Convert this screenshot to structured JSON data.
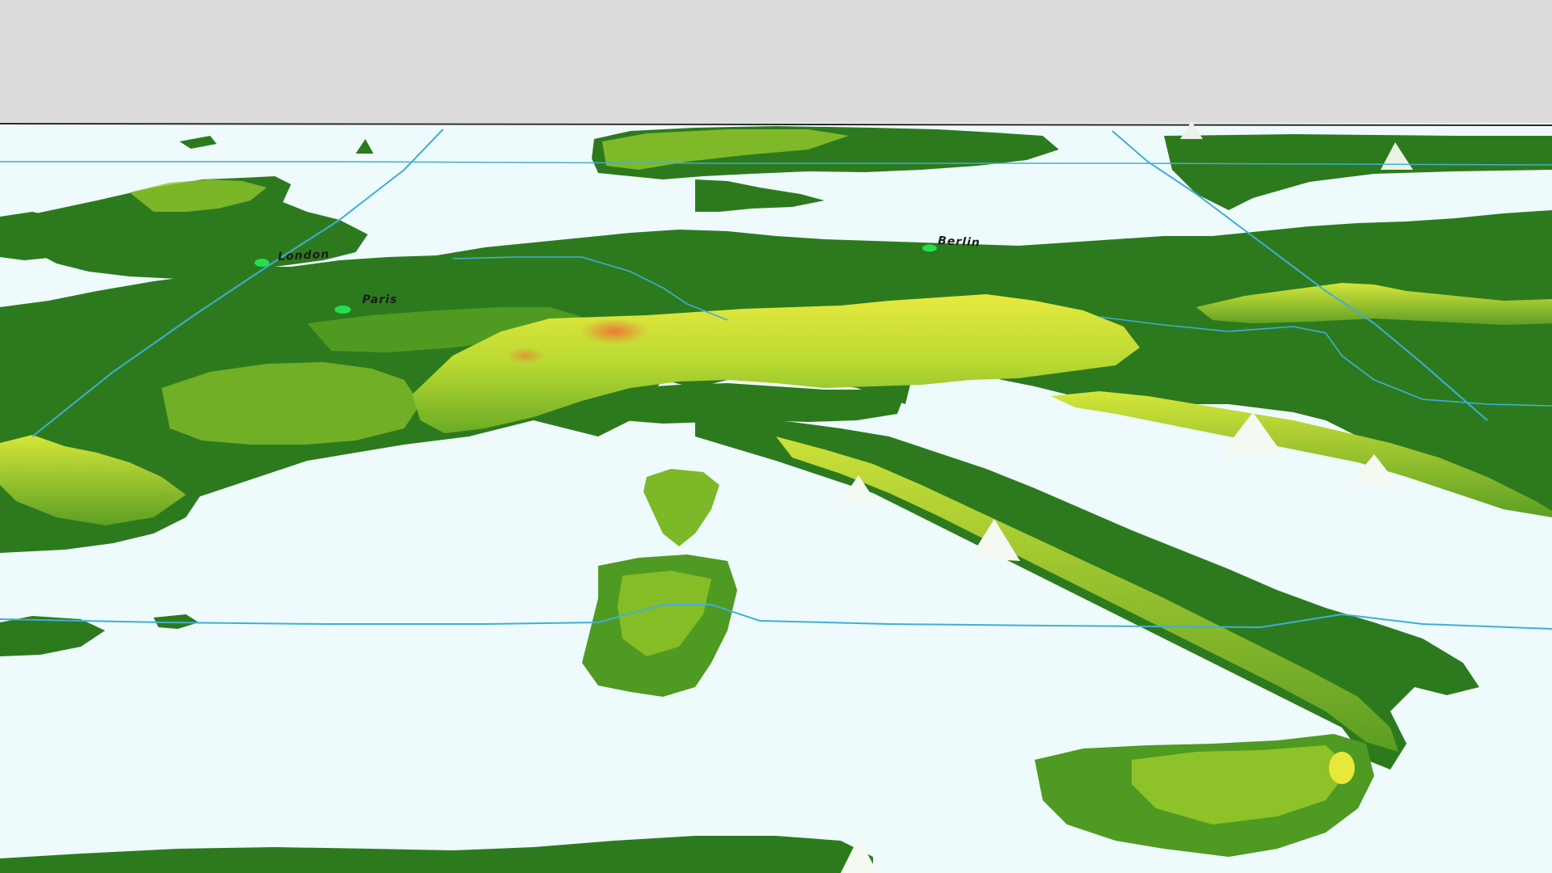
{
  "map": {
    "colors": {
      "sky": "#dcdcdc",
      "sea": "#eefafb",
      "lowland": "#2d7a1e",
      "midland": "#5aa323",
      "highland": "#9ccc2a",
      "upland": "#d9e83a",
      "peak": "#ec7a36",
      "snow": "#ffffff",
      "graticule": "#3fb0d4",
      "city": "#23e04c",
      "horizon": "#2a2a2a"
    },
    "cities": [
      {
        "name": "London"
      },
      {
        "name": "Paris"
      },
      {
        "name": "Berlin"
      }
    ]
  }
}
